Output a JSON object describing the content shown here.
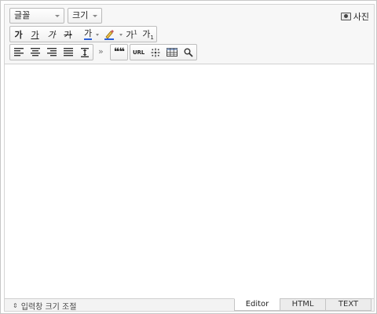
{
  "toolbar": {
    "font_select": "글꼴",
    "size_select": "크기",
    "photo_label": "사진",
    "format_buttons": [
      {
        "glyph": "가",
        "icon": "bold-icon"
      },
      {
        "glyph": "가",
        "icon": "underline-icon"
      },
      {
        "glyph": "가",
        "icon": "italic-icon"
      },
      {
        "glyph": "가",
        "icon": "strikethrough-icon"
      },
      {
        "glyph": "가",
        "icon": "font-color-icon"
      },
      {
        "glyph": "",
        "icon": "highlight-color-icon"
      },
      {
        "glyph": "가",
        "sup": "1",
        "icon": "superscript-icon"
      },
      {
        "glyph": "가",
        "sub": "1",
        "icon": "subscript-icon"
      }
    ],
    "more_label": "»",
    "quote_label": "❝❝",
    "url_label": "URL",
    "special_char_icon": "special-character-icon",
    "table_icon": "table-icon",
    "find_icon": "search-icon",
    "accent_color": "#2b5fd9"
  },
  "bottom": {
    "resize_label": "입력창 크기 조절",
    "tabs": [
      "Editor",
      "HTML",
      "TEXT"
    ],
    "active_tab": "Editor"
  }
}
